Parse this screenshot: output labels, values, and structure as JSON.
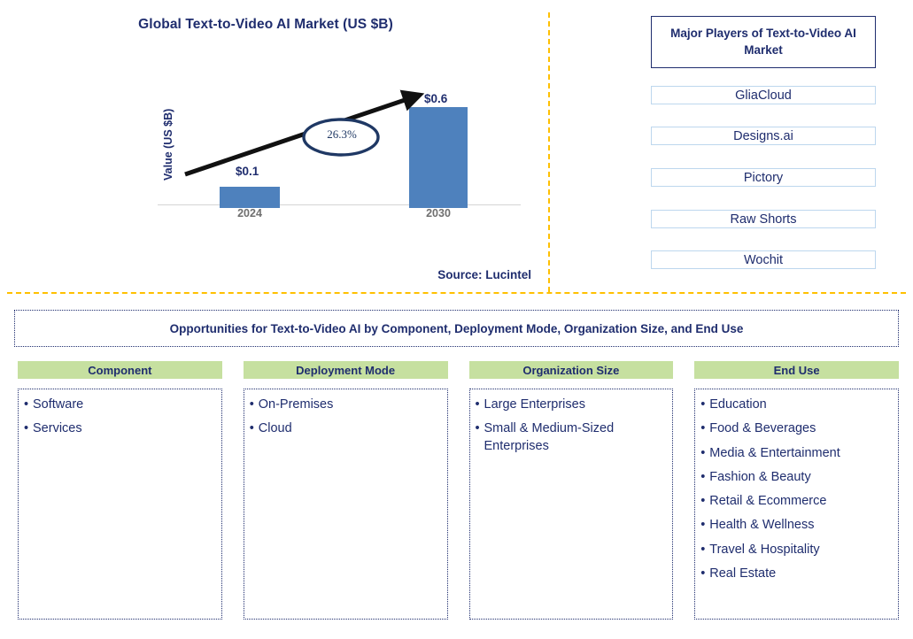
{
  "chart_panel": {
    "title": "Global Text-to-Video AI Market (US $B)",
    "y_axis_label": "Value (US $B)",
    "cagr_label": "26.3%",
    "source": "Source: Lucintel"
  },
  "chart_data": {
    "type": "bar",
    "title": "Global Text-to-Video AI Market (US $B)",
    "categories": [
      "2024",
      "2030"
    ],
    "values": [
      0.1,
      0.6
    ],
    "data_labels": [
      "$0.1",
      "$0.6"
    ],
    "xlabel": "",
    "ylabel": "Value (US $B)",
    "ylim": [
      0,
      0.72
    ],
    "grid": false,
    "legend": "none",
    "annotations": [
      {
        "text": "26.3%",
        "type": "cagr-arrow",
        "from": "2024",
        "to": "2030"
      }
    ],
    "series_color": "#4e81bd",
    "source": "Source: Lucintel"
  },
  "players_panel": {
    "header": "Major Players of Text-to-Video AI Market",
    "items": [
      "GliaCloud",
      "Designs.ai",
      "Pictory",
      "Raw Shorts",
      "Wochit"
    ]
  },
  "opportunities": {
    "banner": "Opportunities for Text-to-Video AI by Component, Deployment Mode, Organization Size, and End Use",
    "segments": [
      {
        "header": "Component",
        "items": [
          "Software",
          "Services"
        ]
      },
      {
        "header": "Deployment Mode",
        "items": [
          "On-Premises",
          "Cloud"
        ]
      },
      {
        "header": "Organization Size",
        "items": [
          "Large Enterprises",
          "Small & Medium-Sized Enterprises"
        ]
      },
      {
        "header": "End Use",
        "items": [
          "Education",
          "Food & Beverages",
          "Media & Entertainment",
          "Fashion & Beauty",
          "Retail & Ecommerce",
          "Health & Wellness",
          "Travel & Hospitality",
          "Real Estate"
        ]
      }
    ]
  },
  "colors": {
    "navy": "#1f2d6e",
    "bar_blue": "#4e81bd",
    "divider_yellow": "#ffc000",
    "header_green": "#c6e0a0",
    "player_border": "#bdd7ee"
  }
}
